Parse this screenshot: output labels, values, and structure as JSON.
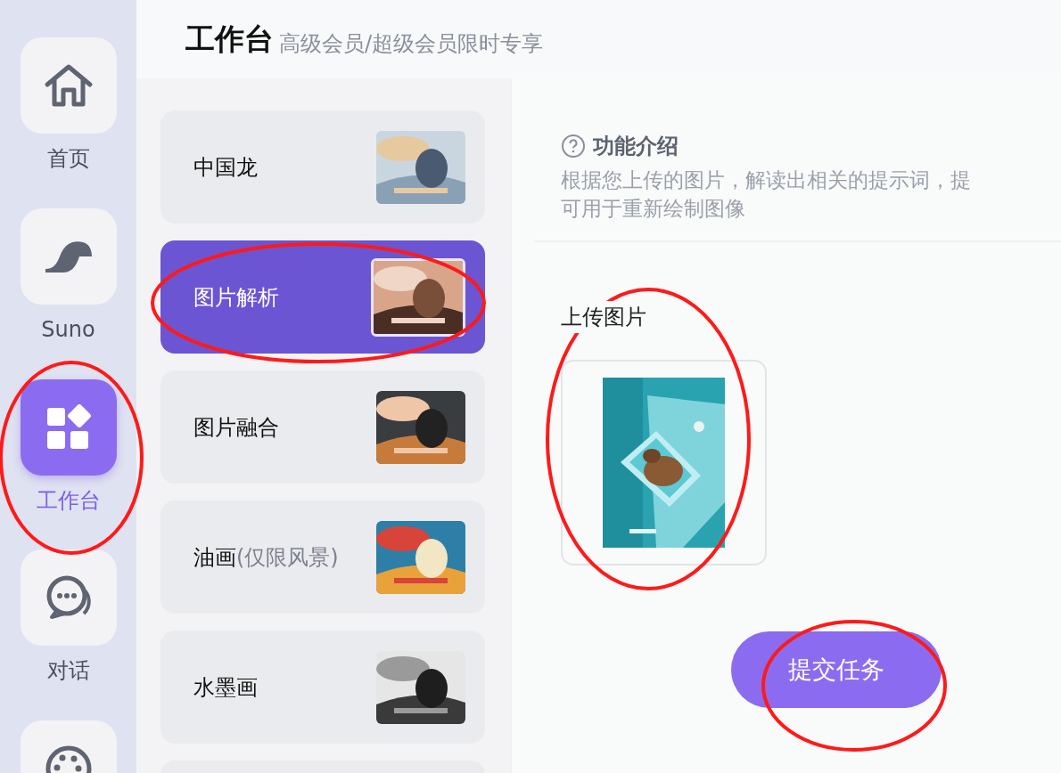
{
  "nav": [
    {
      "kind": "home",
      "label": "首页",
      "selected": false
    },
    {
      "kind": "wave",
      "label": "Suno",
      "selected": false
    },
    {
      "kind": "grid",
      "label": "工作台",
      "selected": true
    },
    {
      "kind": "chat",
      "label": "对话",
      "selected": false
    },
    {
      "kind": "palette",
      "selected": false
    }
  ],
  "header": {
    "title": "工作台",
    "subtitle": "高级会员/超级会员限时专享"
  },
  "tools": [
    {
      "label": "中国龙",
      "selected": false
    },
    {
      "label": "图片解析",
      "selected": true
    },
    {
      "label": "图片融合",
      "selected": false
    },
    {
      "label": "油画",
      "note": "(仅限风景)",
      "selected": false
    },
    {
      "label": "水墨画",
      "selected": false
    },
    {
      "selected": false
    }
  ],
  "intro": {
    "heading": "功能介绍",
    "text": "根据您上传的图片，解读出相关的提示词，提",
    "text_2": "可用于重新绘制图像"
  },
  "upload": {
    "label": "上传图片"
  },
  "submit": {
    "label": "提交任务"
  }
}
